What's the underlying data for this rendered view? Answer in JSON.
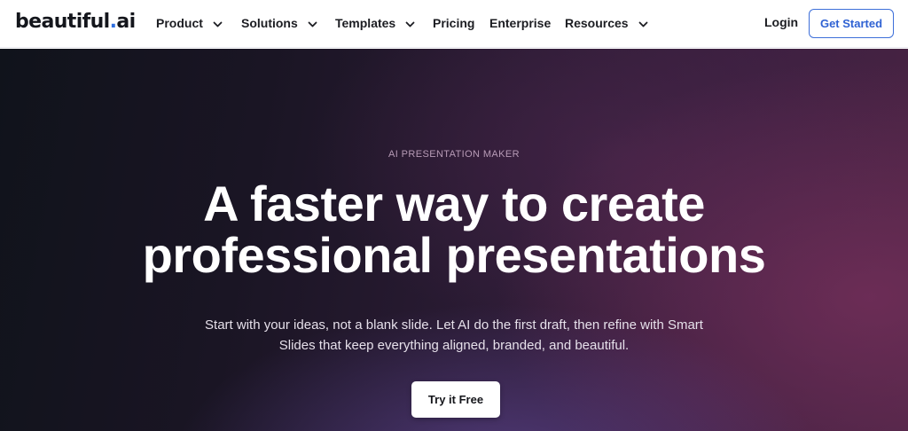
{
  "brand": {
    "logo_prefix": "beautiful",
    "logo_dot": ".",
    "logo_suffix": "ai"
  },
  "nav": {
    "items": [
      {
        "label": "Product",
        "has_dropdown": true
      },
      {
        "label": "Solutions",
        "has_dropdown": true
      },
      {
        "label": "Templates",
        "has_dropdown": true
      },
      {
        "label": "Pricing",
        "has_dropdown": false
      },
      {
        "label": "Enterprise",
        "has_dropdown": false
      },
      {
        "label": "Resources",
        "has_dropdown": true
      }
    ],
    "login_label": "Login",
    "get_started_label": "Get Started"
  },
  "hero": {
    "eyebrow": "AI PRESENTATION MAKER",
    "headline_line1": "A faster way to create",
    "headline_line2": "professional presentations",
    "subtitle_line1": "Start with your ideas, not a blank slide. Let AI do the first draft, then refine with Smart",
    "subtitle_line2": "Slides that keep everything aligned, branded, and beautiful.",
    "cta_label": "Try it Free"
  },
  "colors": {
    "accent": "#2f62d3",
    "logo_dot": "#2f6fe0",
    "hero_dark": "#10131b",
    "hero_plum": "#4a2444"
  },
  "icons": {
    "dropdown": "chevron-down-icon"
  }
}
